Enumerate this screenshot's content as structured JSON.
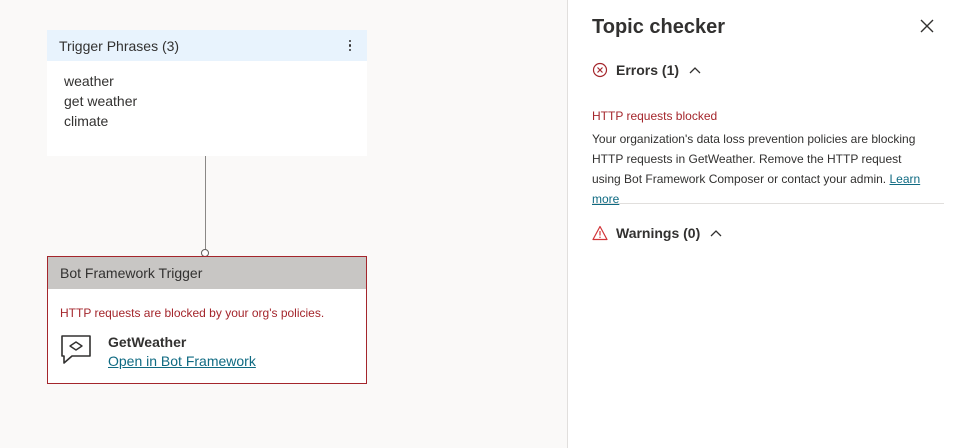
{
  "canvas": {
    "trigger_card": {
      "title": "Trigger Phrases (3)",
      "phrases": [
        "weather",
        "get weather",
        "climate"
      ]
    },
    "bot_card": {
      "title": "Bot Framework Trigger",
      "error": "HTTP requests are blocked by your org's policies.",
      "name": "GetWeather",
      "link": "Open in Bot Framework"
    }
  },
  "panel": {
    "title": "Topic checker",
    "errors": {
      "label": "Errors (1)",
      "items": [
        {
          "title": "HTTP requests blocked",
          "body": "Your organization's data loss prevention policies are blocking HTTP requests in GetWeather. Remove the HTTP request using Bot Framework Composer or contact your admin.",
          "link": "Learn more"
        }
      ]
    },
    "warnings": {
      "label": "Warnings (0)"
    }
  },
  "colors": {
    "error": "#a4262c",
    "link": "#0f6a82",
    "warning": "#d13438",
    "trigger_header": "#e8f3fd",
    "bot_header": "#c8c6c4"
  },
  "icons": {
    "kebab": "more-vertical-icon",
    "chat": "chat-bubble-icon",
    "close": "close-icon",
    "error": "error-circle-icon",
    "warning": "warning-triangle-icon",
    "chevron": "chevron-up-icon"
  }
}
